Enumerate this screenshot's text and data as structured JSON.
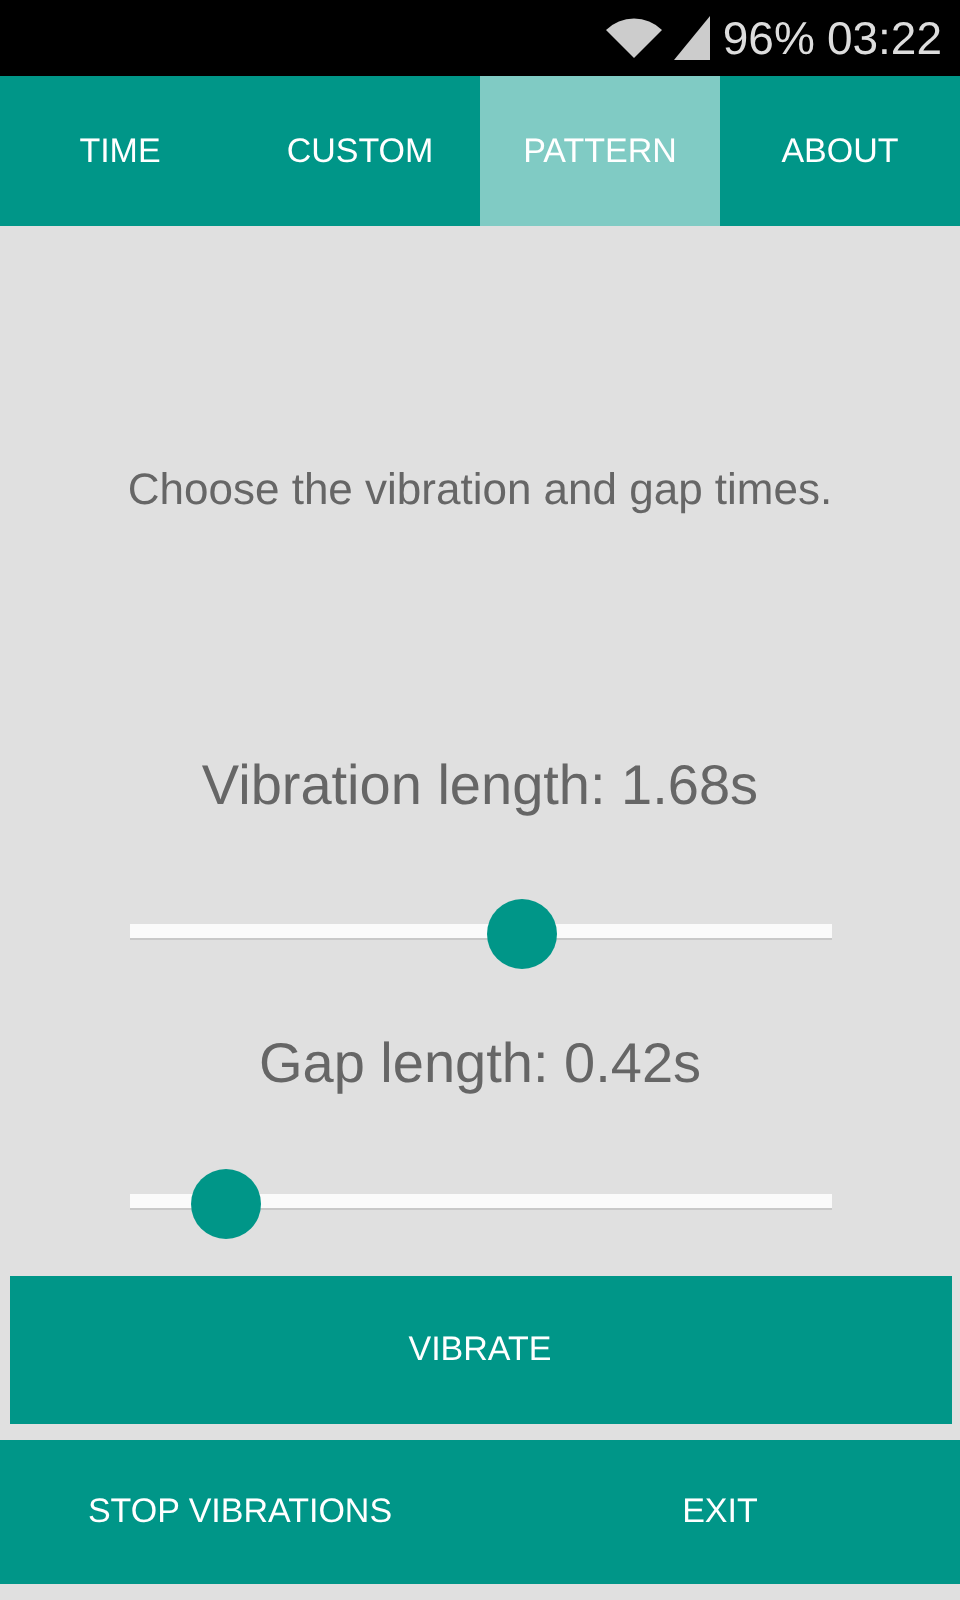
{
  "status_bar": {
    "battery": "96%",
    "time": "03:22"
  },
  "tabs": [
    {
      "label": "TIME",
      "selected": false
    },
    {
      "label": "CUSTOM",
      "selected": false
    },
    {
      "label": "PATTERN",
      "selected": true
    },
    {
      "label": "ABOUT",
      "selected": false
    }
  ],
  "instruction": "Choose the vibration and gap times.",
  "sliders": [
    {
      "label": "Vibration length: 1.68s",
      "level": 0.56
    },
    {
      "label": "Gap length: 0.42s",
      "level": 0.137
    }
  ],
  "vibrate_button": "VIBRATE",
  "bottom_buttons": [
    "STOP VIBRATIONS",
    "EXIT"
  ]
}
